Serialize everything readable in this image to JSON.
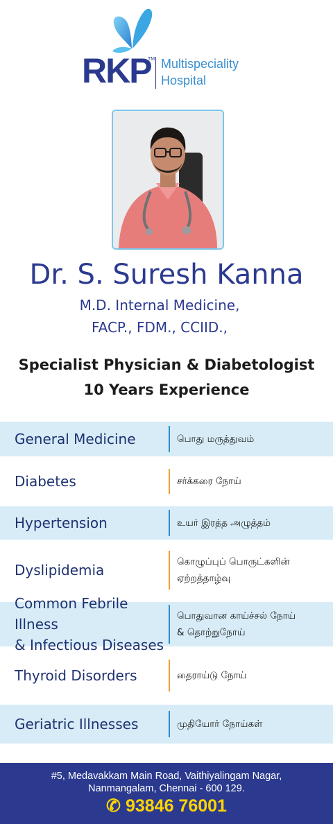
{
  "logo": {
    "brand": "RKP",
    "tm": "TM",
    "line1": "Multispeciality",
    "line2": "Hospital"
  },
  "doctor": {
    "name": "Dr. S. Suresh Kanna",
    "degree1": "M.D. Internal Medicine,",
    "degree2": "FACP., FDM., CCIID.,",
    "specialty": "Specialist Physician & Diabetologist",
    "experience": "10 Years Experience"
  },
  "services": [
    {
      "en": [
        "General Medicine"
      ],
      "ta": [
        "பொது மருத்துவம்"
      ]
    },
    {
      "en": [
        "Diabetes"
      ],
      "ta": [
        "சர்க்கரை நோய்"
      ]
    },
    {
      "en": [
        "Hypertension"
      ],
      "ta": [
        "உயர் இரத்த அழுத்தம்"
      ]
    },
    {
      "en": [
        "Dyslipidemia"
      ],
      "ta": [
        "கொழுப்புப் பொருட்களின்",
        "ஏற்றத்தாழ்வு"
      ]
    },
    {
      "en": [
        "Common Febrile Illness",
        "& Infectious Diseases"
      ],
      "ta": [
        "பொதுவான காய்ச்சல் நோய்",
        "& தொற்றுநோய்"
      ]
    },
    {
      "en": [
        "Thyroid Disorders"
      ],
      "ta": [
        "தைராய்டு நோய்"
      ]
    },
    {
      "en": [
        "Geriatric Illnesses"
      ],
      "ta": [
        "முதியோர் நோய்கள்"
      ]
    }
  ],
  "footer": {
    "address1": "#5, Medavakkam Main Road, Vaithiyalingam Nagar,",
    "address2": "Nanmangalam, Chennai - 600 129.",
    "phone_icon": "phone-icon",
    "phone": "93846 76001"
  },
  "colors": {
    "brand_blue": "#2b3a8f",
    "light_blue": "#3a8fd0",
    "row_shade": "#d7ecf7",
    "accent_orange": "#f0a038",
    "phone_yellow": "#ffd400"
  }
}
